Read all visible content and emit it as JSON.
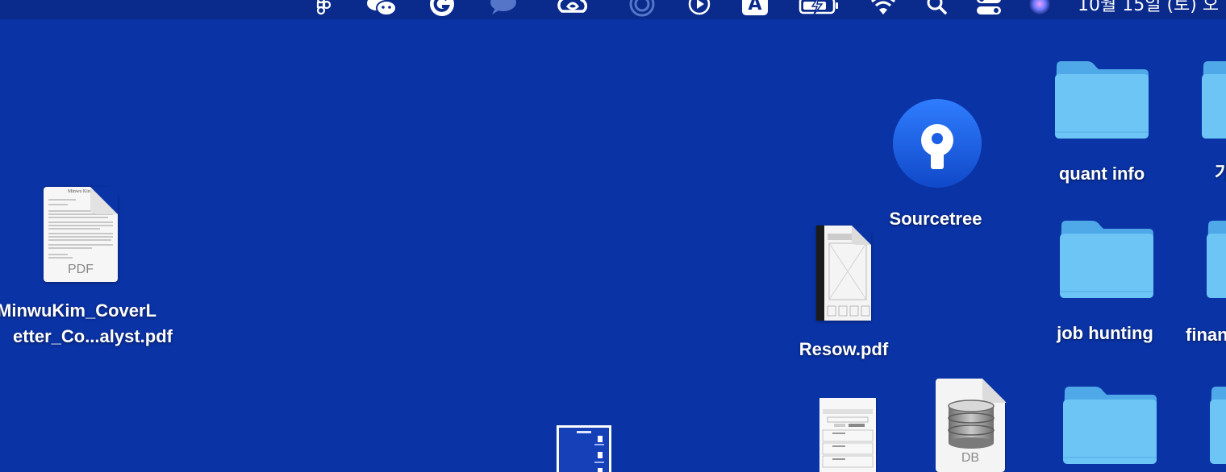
{
  "desktop": {
    "background_color": "#0a33a6"
  },
  "menubar": {
    "icons": [
      "figma-icon",
      "wechat-icon",
      "grammarly-icon",
      "messages-icon",
      "creative-cloud-icon",
      "vpn-icon",
      "media-player-icon",
      "input-source-icon",
      "battery-icon",
      "wifi-icon",
      "spotlight-search-icon",
      "control-center-icon",
      "siri-icon"
    ],
    "input_source_label": "A",
    "clock": "10월 15일 (토) 오"
  },
  "items": {
    "cover_letter": {
      "line1": "MinwuKim_CoverL",
      "line2": "etter_Co...alyst.pdf",
      "type_label": "PDF",
      "doc_header": "Minwu Kim"
    },
    "sourcetree": {
      "label": "Sourcetree"
    },
    "resow": {
      "label": "Resow.pdf"
    },
    "quant_info": {
      "label": "quant info"
    },
    "job_hunting": {
      "label": "job hunting"
    },
    "finance_partial": {
      "label": "finan"
    },
    "korean_partial": {
      "label": "가"
    },
    "db_file": {
      "type_label": "DB"
    }
  }
}
